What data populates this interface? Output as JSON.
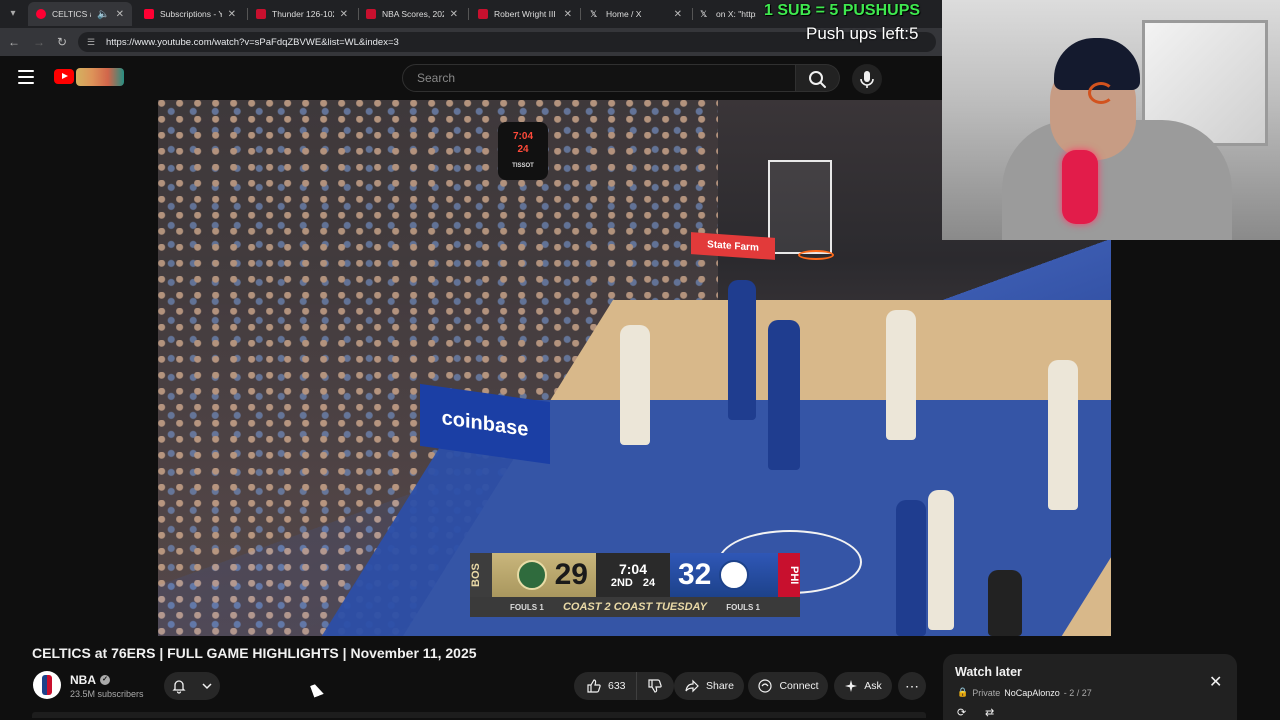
{
  "browser": {
    "tabs": [
      {
        "label": "CELTICS at 76",
        "fav_color": "#ff0033",
        "active": true
      },
      {
        "label": "Subscriptions - Yo",
        "fav_color": "#ff0033",
        "active": false
      },
      {
        "label": "Thunder 126-102",
        "fav_color": "#c8102e",
        "active": false
      },
      {
        "label": "NBA Scores, 2025",
        "fav_color": "#c8102e",
        "active": false
      },
      {
        "label": "Robert Wright III",
        "fav_color": "#c8102e",
        "active": false
      },
      {
        "label": "Home / X",
        "fav_color": "#ffffff",
        "active": false
      },
      {
        "label": "on X: \"https",
        "fav_color": "#ffffff",
        "active": false
      }
    ],
    "url": "https://www.youtube.com/watch?v=sPaFdqZBVWE&list=WL&index=3"
  },
  "header": {
    "search_placeholder": "Search"
  },
  "video": {
    "shot_clock": {
      "game": "7:04",
      "shot": "24",
      "brand": "TISSOT"
    },
    "ads": {
      "coinbase": "coinbase",
      "statefarm": "State Farm"
    },
    "scorebug": {
      "away_abbr": "BOS",
      "away_score": "29",
      "clock": "7:04",
      "period": "2ND",
      "shot_clock": "24",
      "home_score": "32",
      "home_abbr": "PHI",
      "away_fouls": "FOULS 1",
      "home_fouls": "FOULS 1",
      "banner": "COAST 2 COAST TUESDAY"
    }
  },
  "overlay": {
    "sub_banner": "1 SUB = 5 PUSHUPS",
    "pushups_left": "Push ups left:5"
  },
  "meta": {
    "title": "CELTICS at 76ERS | FULL GAME HIGHLIGHTS | November 11, 2025",
    "channel_name": "NBA",
    "subscribers": "23.5M subscribers",
    "like_count": "633",
    "share_label": "Share",
    "connect_label": "Connect",
    "ask_label": "Ask"
  },
  "watch_later": {
    "title": "Watch later",
    "privacy": "Private",
    "owner": "NoCapAlonzo",
    "position": "- 2 / 27"
  },
  "icons": {
    "tab_menu": "chevron-down-icon",
    "back": "back-arrow-icon",
    "forward": "forward-arrow-icon",
    "reload": "reload-icon",
    "search": "search-icon",
    "mic": "mic-icon",
    "bell": "bell-icon",
    "like": "thumbs-up-icon",
    "dislike": "thumbs-down-icon",
    "share": "share-icon",
    "connect": "connect-icon",
    "ask": "sparkle-icon",
    "more": "more-icon",
    "close": "close-icon",
    "loop": "loop-icon",
    "shuffle": "shuffle-icon"
  }
}
